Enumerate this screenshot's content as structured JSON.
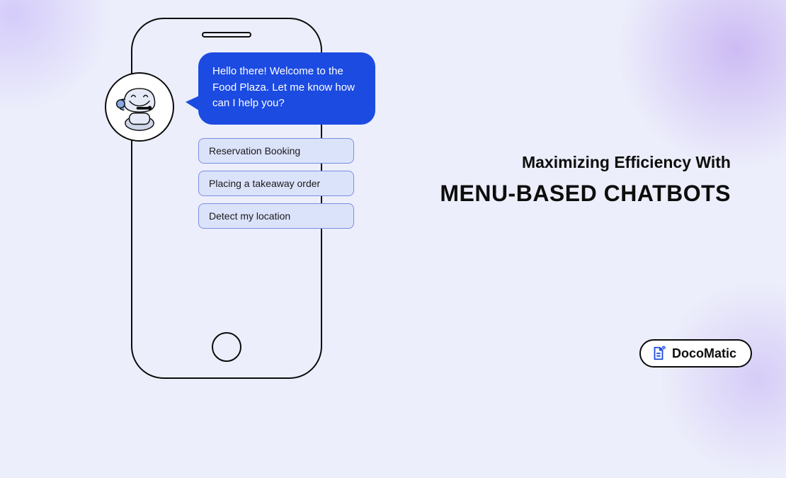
{
  "bubble": {
    "text": "Hello there! Welcome to the Food Plaza. Let me know how can I help you?"
  },
  "options": [
    {
      "label": "Reservation Booking"
    },
    {
      "label": "Placing a takeaway order"
    },
    {
      "label": "Detect my location"
    }
  ],
  "headline": {
    "subtitle": "Maximizing Efficiency With",
    "title": "MENU-BASED CHATBOTS"
  },
  "brand": {
    "name": "DocoMatic"
  }
}
